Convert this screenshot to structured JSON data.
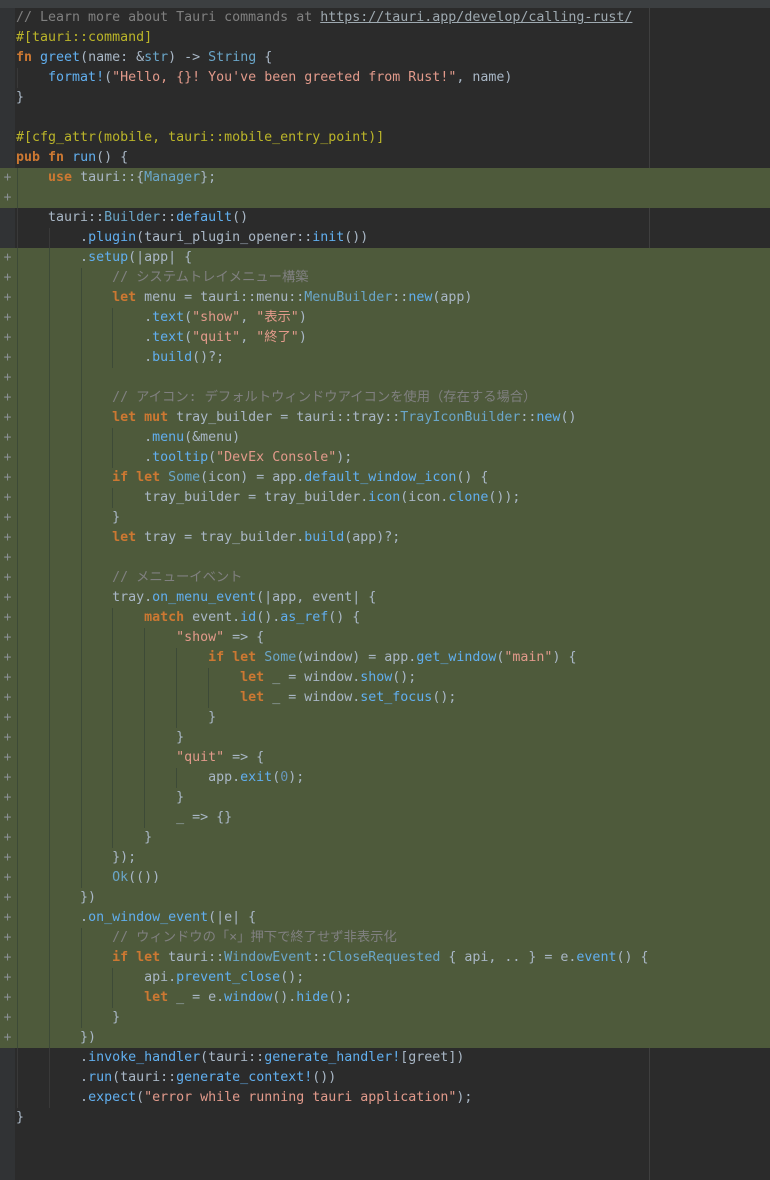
{
  "editor": {
    "language": "rust",
    "lines": [
      {
        "added": false,
        "depth": 0,
        "html": "<span class=\"cm\">// Learn more about Tauri commands at <span class=\"url\">https://tauri.app/develop/calling-rust/</span></span>"
      },
      {
        "added": false,
        "depth": 0,
        "html": "<span class=\"attr\">#[tauri::command]</span>"
      },
      {
        "added": false,
        "depth": 0,
        "html": "<span class=\"kw\">fn</span> <span class=\"fn\">greet</span>(name: &amp;<span class=\"ty\">str</span>) -&gt; <span class=\"ty\">String</span> {"
      },
      {
        "added": false,
        "depth": 1,
        "html": "    <span class=\"mac\">format!</span>(<span class=\"st\">\"Hello, {}! You've been greeted from Rust!\"</span>, name)"
      },
      {
        "added": false,
        "depth": 0,
        "html": "}"
      },
      {
        "added": false,
        "depth": 0,
        "html": ""
      },
      {
        "added": false,
        "depth": 0,
        "html": "<span class=\"attr\">#[cfg_attr(mobile, tauri::mobile_entry_point)]</span>"
      },
      {
        "added": false,
        "depth": 0,
        "html": "<span class=\"kw\">pub fn</span> <span class=\"fn\">run</span>() {"
      },
      {
        "added": true,
        "depth": 1,
        "html": "    <span class=\"kw\">use</span> tauri::{<span class=\"ty\">Manager</span>};"
      },
      {
        "added": true,
        "depth": 1,
        "html": ""
      },
      {
        "added": false,
        "depth": 1,
        "html": "    tauri::<span class=\"ty\">Builder</span>::<span class=\"fn\">default</span>()"
      },
      {
        "added": false,
        "depth": 2,
        "html": "        .<span class=\"fn\">plugin</span>(tauri_plugin_opener::<span class=\"fn\">init</span>())"
      },
      {
        "added": true,
        "depth": 2,
        "html": "        .<span class=\"fn\">setup</span>(|app| {"
      },
      {
        "added": true,
        "depth": 3,
        "html": "            <span class=\"cm\">// システムトレイメニュー構築</span>"
      },
      {
        "added": true,
        "depth": 3,
        "html": "            <span class=\"kw\">let</span> menu = tauri::menu::<span class=\"ty\">MenuBuilder</span>::<span class=\"fn\">new</span>(app)"
      },
      {
        "added": true,
        "depth": 4,
        "html": "                .<span class=\"fn\">text</span>(<span class=\"st\">\"show\"</span>, <span class=\"st\">\"表示\"</span>)"
      },
      {
        "added": true,
        "depth": 4,
        "html": "                .<span class=\"fn\">text</span>(<span class=\"st\">\"quit\"</span>, <span class=\"st\">\"終了\"</span>)"
      },
      {
        "added": true,
        "depth": 4,
        "html": "                .<span class=\"fn\">build</span>()?;"
      },
      {
        "added": true,
        "depth": 3,
        "html": ""
      },
      {
        "added": true,
        "depth": 3,
        "html": "            <span class=\"cm\">// アイコン: デフォルトウィンドウアイコンを使用（存在する場合）</span>"
      },
      {
        "added": true,
        "depth": 3,
        "html": "            <span class=\"kw\">let mut</span> tray_builder = tauri::tray::<span class=\"ty\">TrayIconBuilder</span>::<span class=\"fn\">new</span>()"
      },
      {
        "added": true,
        "depth": 4,
        "html": "                .<span class=\"fn\">menu</span>(&amp;menu)"
      },
      {
        "added": true,
        "depth": 4,
        "html": "                .<span class=\"fn\">tooltip</span>(<span class=\"st\">\"DevEx Console\"</span>);"
      },
      {
        "added": true,
        "depth": 3,
        "html": "            <span class=\"kw\">if let</span> <span class=\"ty\">Some</span>(icon) = app.<span class=\"fn\">default_window_icon</span>() {"
      },
      {
        "added": true,
        "depth": 4,
        "html": "                tray_builder = tray_builder.<span class=\"fn\">icon</span>(icon.<span class=\"fn\">clone</span>());"
      },
      {
        "added": true,
        "depth": 3,
        "html": "            }"
      },
      {
        "added": true,
        "depth": 3,
        "html": "            <span class=\"kw\">let</span> tray = tray_builder.<span class=\"fn\">build</span>(app)?;"
      },
      {
        "added": true,
        "depth": 3,
        "html": ""
      },
      {
        "added": true,
        "depth": 3,
        "html": "            <span class=\"cm\">// メニューイベント</span>"
      },
      {
        "added": true,
        "depth": 3,
        "html": "            tray.<span class=\"fn\">on_menu_event</span>(|app, event| {"
      },
      {
        "added": true,
        "depth": 4,
        "html": "                <span class=\"kw\">match</span> event.<span class=\"fn\">id</span>().<span class=\"fn\">as_ref</span>() {"
      },
      {
        "added": true,
        "depth": 5,
        "html": "                    <span class=\"st\">\"show\"</span> =&gt; {"
      },
      {
        "added": true,
        "depth": 6,
        "html": "                        <span class=\"kw\">if let</span> <span class=\"ty\">Some</span>(window) = app.<span class=\"fn\">get_window</span>(<span class=\"st\">\"main\"</span>) {"
      },
      {
        "added": true,
        "depth": 7,
        "html": "                            <span class=\"kw\">let</span> _ = window.<span class=\"fn\">show</span>();"
      },
      {
        "added": true,
        "depth": 7,
        "html": "                            <span class=\"kw\">let</span> _ = window.<span class=\"fn\">set_focus</span>();"
      },
      {
        "added": true,
        "depth": 6,
        "html": "                        }"
      },
      {
        "added": true,
        "depth": 5,
        "html": "                    }"
      },
      {
        "added": true,
        "depth": 5,
        "html": "                    <span class=\"st\">\"quit\"</span> =&gt; {"
      },
      {
        "added": true,
        "depth": 6,
        "html": "                        app.<span class=\"fn\">exit</span>(<span class=\"num\">0</span>);"
      },
      {
        "added": true,
        "depth": 5,
        "html": "                    }"
      },
      {
        "added": true,
        "depth": 5,
        "html": "                    _ =&gt; {}"
      },
      {
        "added": true,
        "depth": 4,
        "html": "                }"
      },
      {
        "added": true,
        "depth": 3,
        "html": "            });"
      },
      {
        "added": true,
        "depth": 3,
        "html": "            <span class=\"ty\">Ok</span>(())"
      },
      {
        "added": true,
        "depth": 2,
        "html": "        })"
      },
      {
        "added": true,
        "depth": 2,
        "html": "        .<span class=\"fn\">on_window_event</span>(|e| {"
      },
      {
        "added": true,
        "depth": 3,
        "html": "            <span class=\"cm\">// ウィンドウの「×」押下で終了せず非表示化</span>"
      },
      {
        "added": true,
        "depth": 3,
        "html": "            <span class=\"kw\">if let</span> tauri::<span class=\"ty\">WindowEvent</span>::<span class=\"ty\">CloseRequested</span> { api, .. } = e.<span class=\"fn\">event</span>() {"
      },
      {
        "added": true,
        "depth": 4,
        "html": "                api.<span class=\"fn\">prevent_close</span>();"
      },
      {
        "added": true,
        "depth": 4,
        "html": "                <span class=\"kw\">let</span> _ = e.<span class=\"fn\">window</span>().<span class=\"fn\">hide</span>();"
      },
      {
        "added": true,
        "depth": 3,
        "html": "            }"
      },
      {
        "added": true,
        "depth": 2,
        "html": "        })"
      },
      {
        "added": false,
        "depth": 2,
        "html": "        .<span class=\"fn\">invoke_handler</span>(tauri::<span class=\"mac\">generate_handler!</span>[greet])"
      },
      {
        "added": false,
        "depth": 2,
        "html": "        .<span class=\"fn\">run</span>(tauri::<span class=\"mac\">generate_context!</span>())"
      },
      {
        "added": false,
        "depth": 2,
        "html": "        .<span class=\"fn\">expect</span>(<span class=\"st\">\"error while running tauri application\"</span>);"
      },
      {
        "added": false,
        "depth": 0,
        "html": "}"
      }
    ]
  }
}
